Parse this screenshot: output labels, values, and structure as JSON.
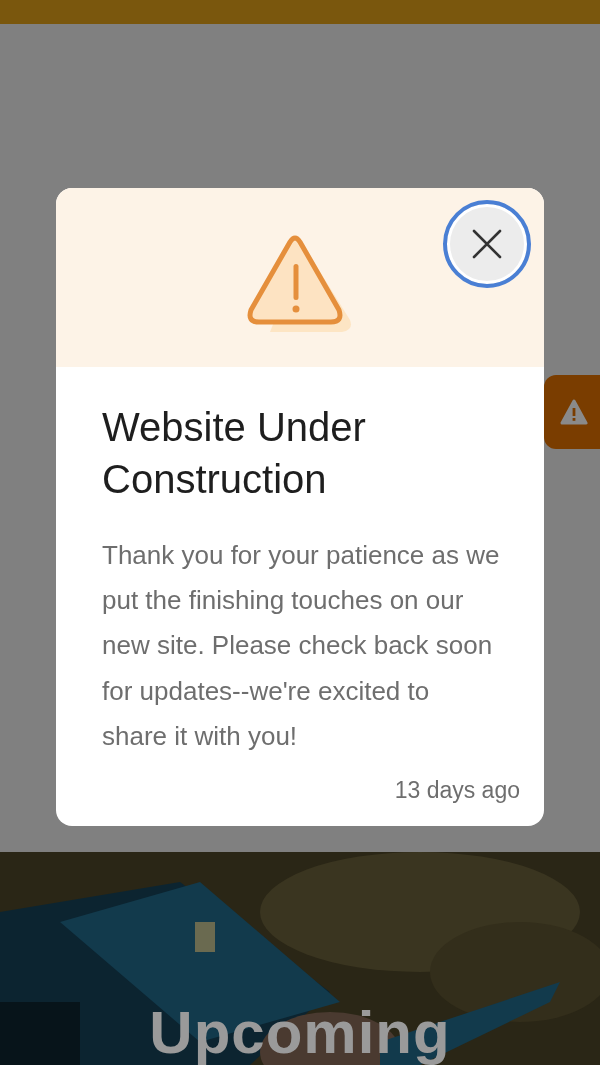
{
  "side_tab": {
    "kind": "warning"
  },
  "modal": {
    "title": "Website Under Construction",
    "message": "Thank you for your patience as we put the finishing touches on our new site. Please check back soon for updates--we're excited to share it with you!",
    "time": "13 days ago"
  },
  "hero": {
    "heading": "Upcoming",
    "kind": "picture"
  }
}
